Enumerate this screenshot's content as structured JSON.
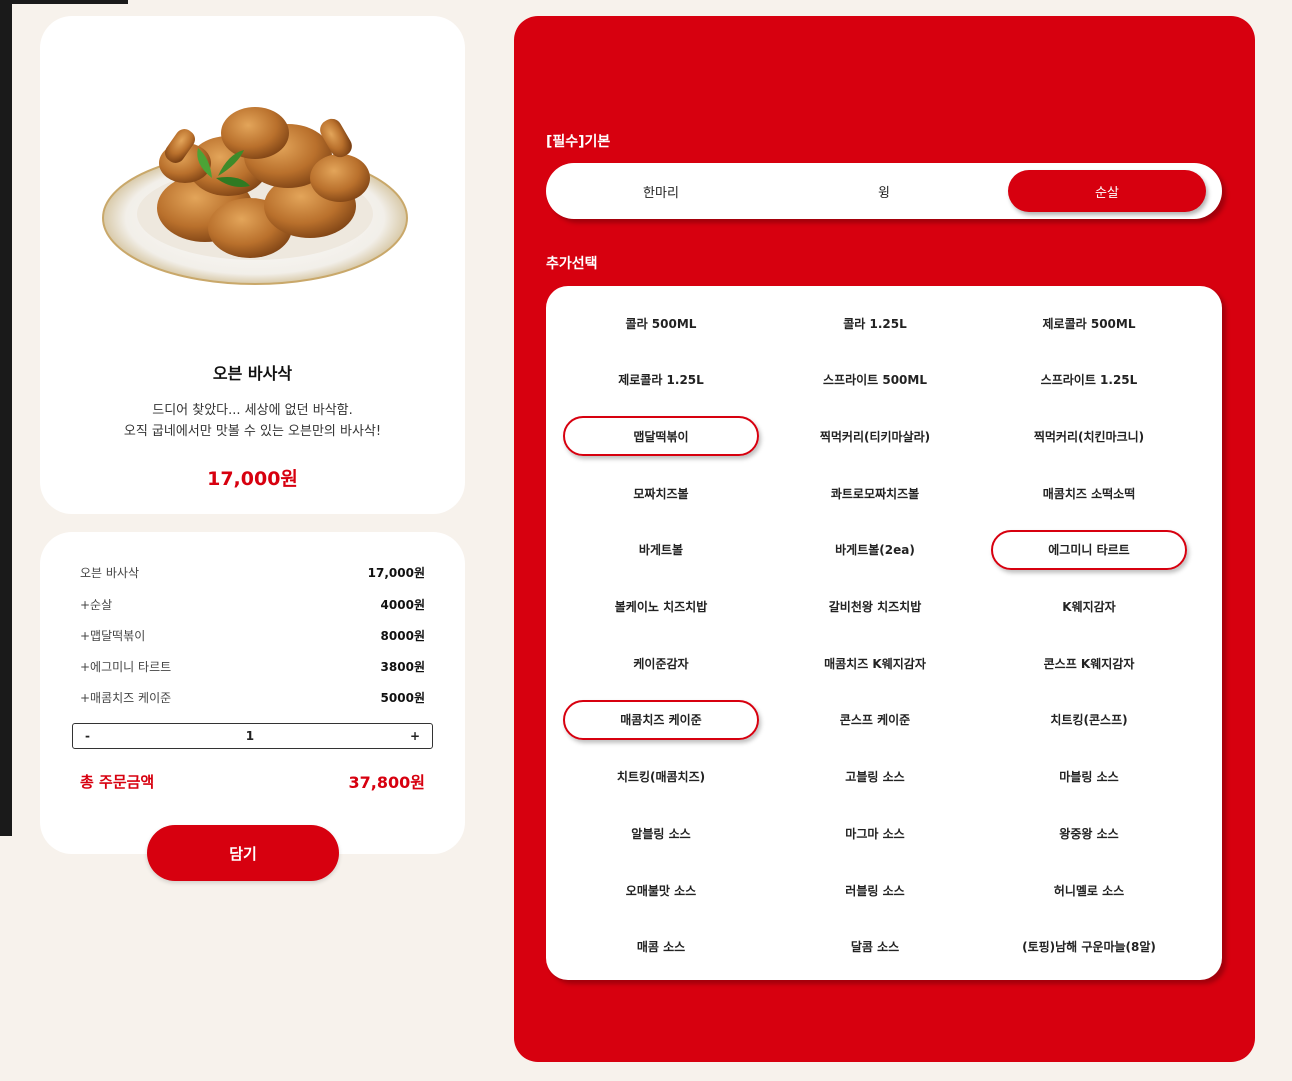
{
  "product": {
    "name": "오븐 바사삭",
    "description_line1": "드디어 찾았다... 세상에 없던 바삭함.",
    "description_line2": "오직 굽네에서만 맛볼 수 있는 오븐만의 바사삭!",
    "price": "17,000원"
  },
  "summary": {
    "items": [
      {
        "name": "오븐 바사삭",
        "price": "17,000원"
      },
      {
        "name": "+순살",
        "price": "4000원"
      },
      {
        "name": "+맵달떡볶이",
        "price": "8000원"
      },
      {
        "name": "+에그미니 타르트",
        "price": "3800원"
      },
      {
        "name": "+매콤치즈 케이준",
        "price": "5000원"
      }
    ],
    "quantity": {
      "minus": "-",
      "value": "1",
      "plus": "+"
    },
    "total_label": "총 주문금액",
    "total_amount": "37,800원"
  },
  "cart_button": "담기",
  "options": {
    "base_title": "[필수]기본",
    "base_choices": [
      {
        "label": "한마리",
        "active": false
      },
      {
        "label": "윙",
        "active": false
      },
      {
        "label": "순살",
        "active": true
      }
    ],
    "addon_title": "추가선택",
    "addons": [
      {
        "label": "콜라 500ML",
        "selected": false
      },
      {
        "label": "콜라 1.25L",
        "selected": false
      },
      {
        "label": "제로콜라 500ML",
        "selected": false
      },
      {
        "label": "제로콜라 1.25L",
        "selected": false
      },
      {
        "label": "스프라이트 500ML",
        "selected": false
      },
      {
        "label": "스프라이트 1.25L",
        "selected": false
      },
      {
        "label": "맵달떡볶이",
        "selected": true
      },
      {
        "label": "찍먹커리(티키마살라)",
        "selected": false
      },
      {
        "label": "찍먹커리(치킨마크니)",
        "selected": false
      },
      {
        "label": "모짜치즈볼",
        "selected": false
      },
      {
        "label": "콰트로모짜치즈볼",
        "selected": false
      },
      {
        "label": "매콤치즈 소떡소떡",
        "selected": false
      },
      {
        "label": "바게트볼",
        "selected": false
      },
      {
        "label": "바게트볼(2ea)",
        "selected": false
      },
      {
        "label": "에그미니 타르트",
        "selected": true
      },
      {
        "label": "볼케이노 치즈치밥",
        "selected": false
      },
      {
        "label": "갈비천왕 치즈치밥",
        "selected": false
      },
      {
        "label": "K웨지감자",
        "selected": false
      },
      {
        "label": "케이준감자",
        "selected": false
      },
      {
        "label": "매콤치즈 K웨지감자",
        "selected": false
      },
      {
        "label": "콘스프 K웨지감자",
        "selected": false
      },
      {
        "label": "매콤치즈 케이준",
        "selected": true
      },
      {
        "label": "콘스프 케이준",
        "selected": false
      },
      {
        "label": "치트킹(콘스프)",
        "selected": false
      },
      {
        "label": "치트킹(매콤치즈)",
        "selected": false
      },
      {
        "label": "고블링 소스",
        "selected": false
      },
      {
        "label": "마블링 소스",
        "selected": false
      },
      {
        "label": "알블링 소스",
        "selected": false
      },
      {
        "label": "마그마 소스",
        "selected": false
      },
      {
        "label": "왕중왕 소스",
        "selected": false
      },
      {
        "label": "오매불맛 소스",
        "selected": false
      },
      {
        "label": "러블링 소스",
        "selected": false
      },
      {
        "label": "허니멜로 소스",
        "selected": false
      },
      {
        "label": "매콤 소스",
        "selected": false
      },
      {
        "label": "달콤 소스",
        "selected": false
      },
      {
        "label": "(토핑)남해 구운마늘(8알)",
        "selected": false
      }
    ]
  },
  "colors": {
    "brand_red": "#d7000f",
    "background": "#f7f2ec"
  }
}
